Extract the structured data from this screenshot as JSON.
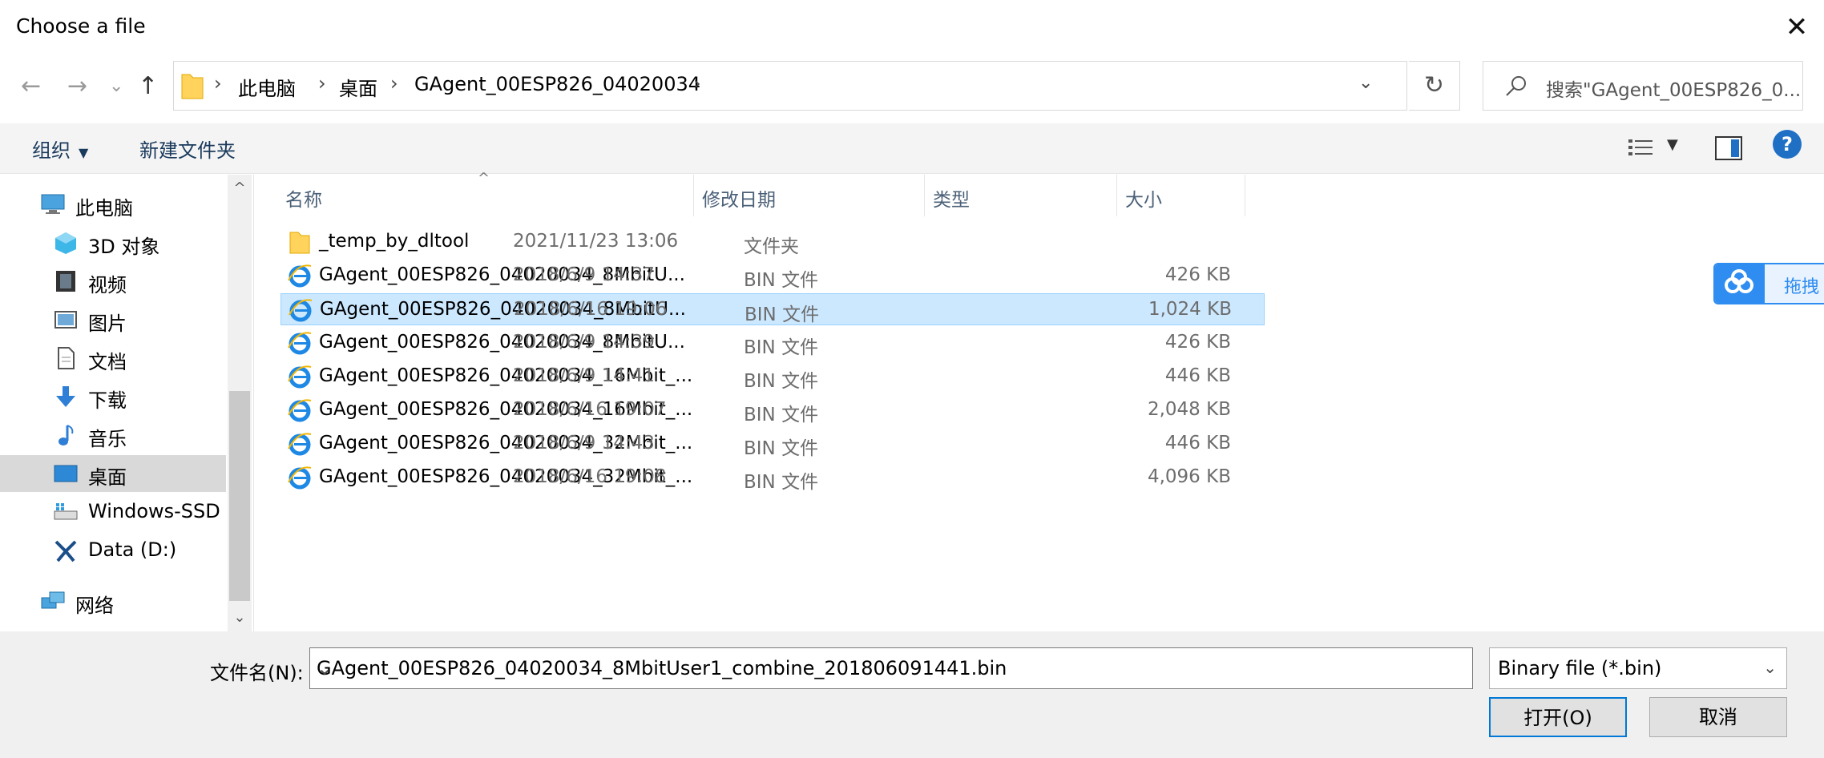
{
  "window": {
    "title": "Choose a file",
    "close_glyph": "✕"
  },
  "nav": {
    "back_glyph": "←",
    "forward_glyph": "→",
    "recent_glyph": "⌄",
    "up_glyph": "↑"
  },
  "address": {
    "crumbs": [
      "此电脑",
      "桌面",
      "GAgent_00ESP826_04020034"
    ],
    "sep": "›",
    "dropdown_glyph": "⌄",
    "refresh_glyph": "↻"
  },
  "search": {
    "placeholder": "搜索\"GAgent_00ESP826_0..."
  },
  "toolbar": {
    "organize_label": "组织",
    "organize_caret": "▼",
    "new_folder_label": "新建文件夹",
    "view_caret": "▼",
    "help_label": "?"
  },
  "sidebar": {
    "items": [
      {
        "label": "此电脑",
        "icon": "computer-icon"
      },
      {
        "label": "3D 对象",
        "icon": "3d-objects-icon"
      },
      {
        "label": "视频",
        "icon": "videos-icon"
      },
      {
        "label": "图片",
        "icon": "pictures-icon"
      },
      {
        "label": "文档",
        "icon": "documents-icon"
      },
      {
        "label": "下载",
        "icon": "downloads-icon"
      },
      {
        "label": "音乐",
        "icon": "music-icon"
      },
      {
        "label": "桌面",
        "icon": "desktop-icon",
        "selected": true
      },
      {
        "label": "Windows-SSD",
        "icon": "drive-icon"
      },
      {
        "label": "Data (D:)",
        "icon": "drive-icon"
      },
      {
        "label": "网络",
        "icon": "network-icon"
      }
    ],
    "scroll_up_glyph": "^",
    "scroll_down_glyph": "⌄"
  },
  "columns": {
    "name": "名称",
    "modified": "修改日期",
    "type": "类型",
    "size": "大小",
    "sort_glyph": "^"
  },
  "files": [
    {
      "name": "_temp_by_dltool",
      "modified": "2021/11/23 13:06",
      "type": "文件夹",
      "size": "",
      "icon": "folder-icon"
    },
    {
      "name": "GAgent_00ESP826_04020034_8MbitU...",
      "modified": "2018/6/9 14:37",
      "type": "BIN 文件",
      "size": "426 KB",
      "icon": "ie-file-icon"
    },
    {
      "name": "GAgent_00ESP826_04020034_8MbitU...",
      "modified": "2018/6/16 19:06",
      "type": "BIN 文件",
      "size": "1,024 KB",
      "icon": "ie-file-icon",
      "selected": true
    },
    {
      "name": "GAgent_00ESP826_04020034_8MbitU...",
      "modified": "2018/6/9 14:39",
      "type": "BIN 文件",
      "size": "426 KB",
      "icon": "ie-file-icon"
    },
    {
      "name": "GAgent_00ESP826_04020034_16Mbit_...",
      "modified": "2018/6/9 14:41",
      "type": "BIN 文件",
      "size": "446 KB",
      "icon": "ie-file-icon"
    },
    {
      "name": "GAgent_00ESP826_04020034_16Mbit_...",
      "modified": "2018/6/16 19:07",
      "type": "BIN 文件",
      "size": "2,048 KB",
      "icon": "ie-file-icon"
    },
    {
      "name": "GAgent_00ESP826_04020034_32Mbit_...",
      "modified": "2018/6/9 14:43",
      "type": "BIN 文件",
      "size": "446 KB",
      "icon": "ie-file-icon"
    },
    {
      "name": "GAgent_00ESP826_04020034_32Mbit_...",
      "modified": "2018/6/16 19:08",
      "type": "BIN 文件",
      "size": "4,096 KB",
      "icon": "ie-file-icon"
    }
  ],
  "side_badge": {
    "label": "拖拽"
  },
  "footer": {
    "filename_label": "文件名(N):",
    "filename_value": "GAgent_00ESP826_04020034_8MbitUser1_combine_201806091441.bin",
    "filter_value": "Binary file (*.bin)",
    "dropdown_glyph": "⌄",
    "open_label": "打开(O)",
    "cancel_label": "取消"
  },
  "colors": {
    "accent": "#0078d7",
    "selection": "#cce8ff",
    "selection_border": "#99d1ff",
    "folder": "#ffd35c",
    "ie_blue": "#1e88e5"
  }
}
